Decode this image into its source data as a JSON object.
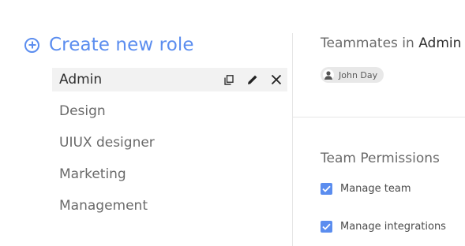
{
  "roles_panel": {
    "create_label": "Create new role",
    "roles": [
      {
        "label": "Admin"
      },
      {
        "label": "Design"
      },
      {
        "label": "UIUX designer"
      },
      {
        "label": "Marketing"
      },
      {
        "label": "Management"
      }
    ]
  },
  "details": {
    "teammates_prefix": "Teammates in",
    "role_name": "Admin",
    "teammates": [
      {
        "name": "John Day",
        "icon": "user-avatar-icon"
      }
    ],
    "permissions_title": "Team Permissions",
    "permissions": [
      {
        "label": "Manage team",
        "checked": true
      },
      {
        "label": "Manage integrations",
        "checked": true
      }
    ]
  },
  "colors": {
    "accent": "#5b8def",
    "selected_row": "#f2f2f2",
    "chip": "#e8e8e8"
  }
}
